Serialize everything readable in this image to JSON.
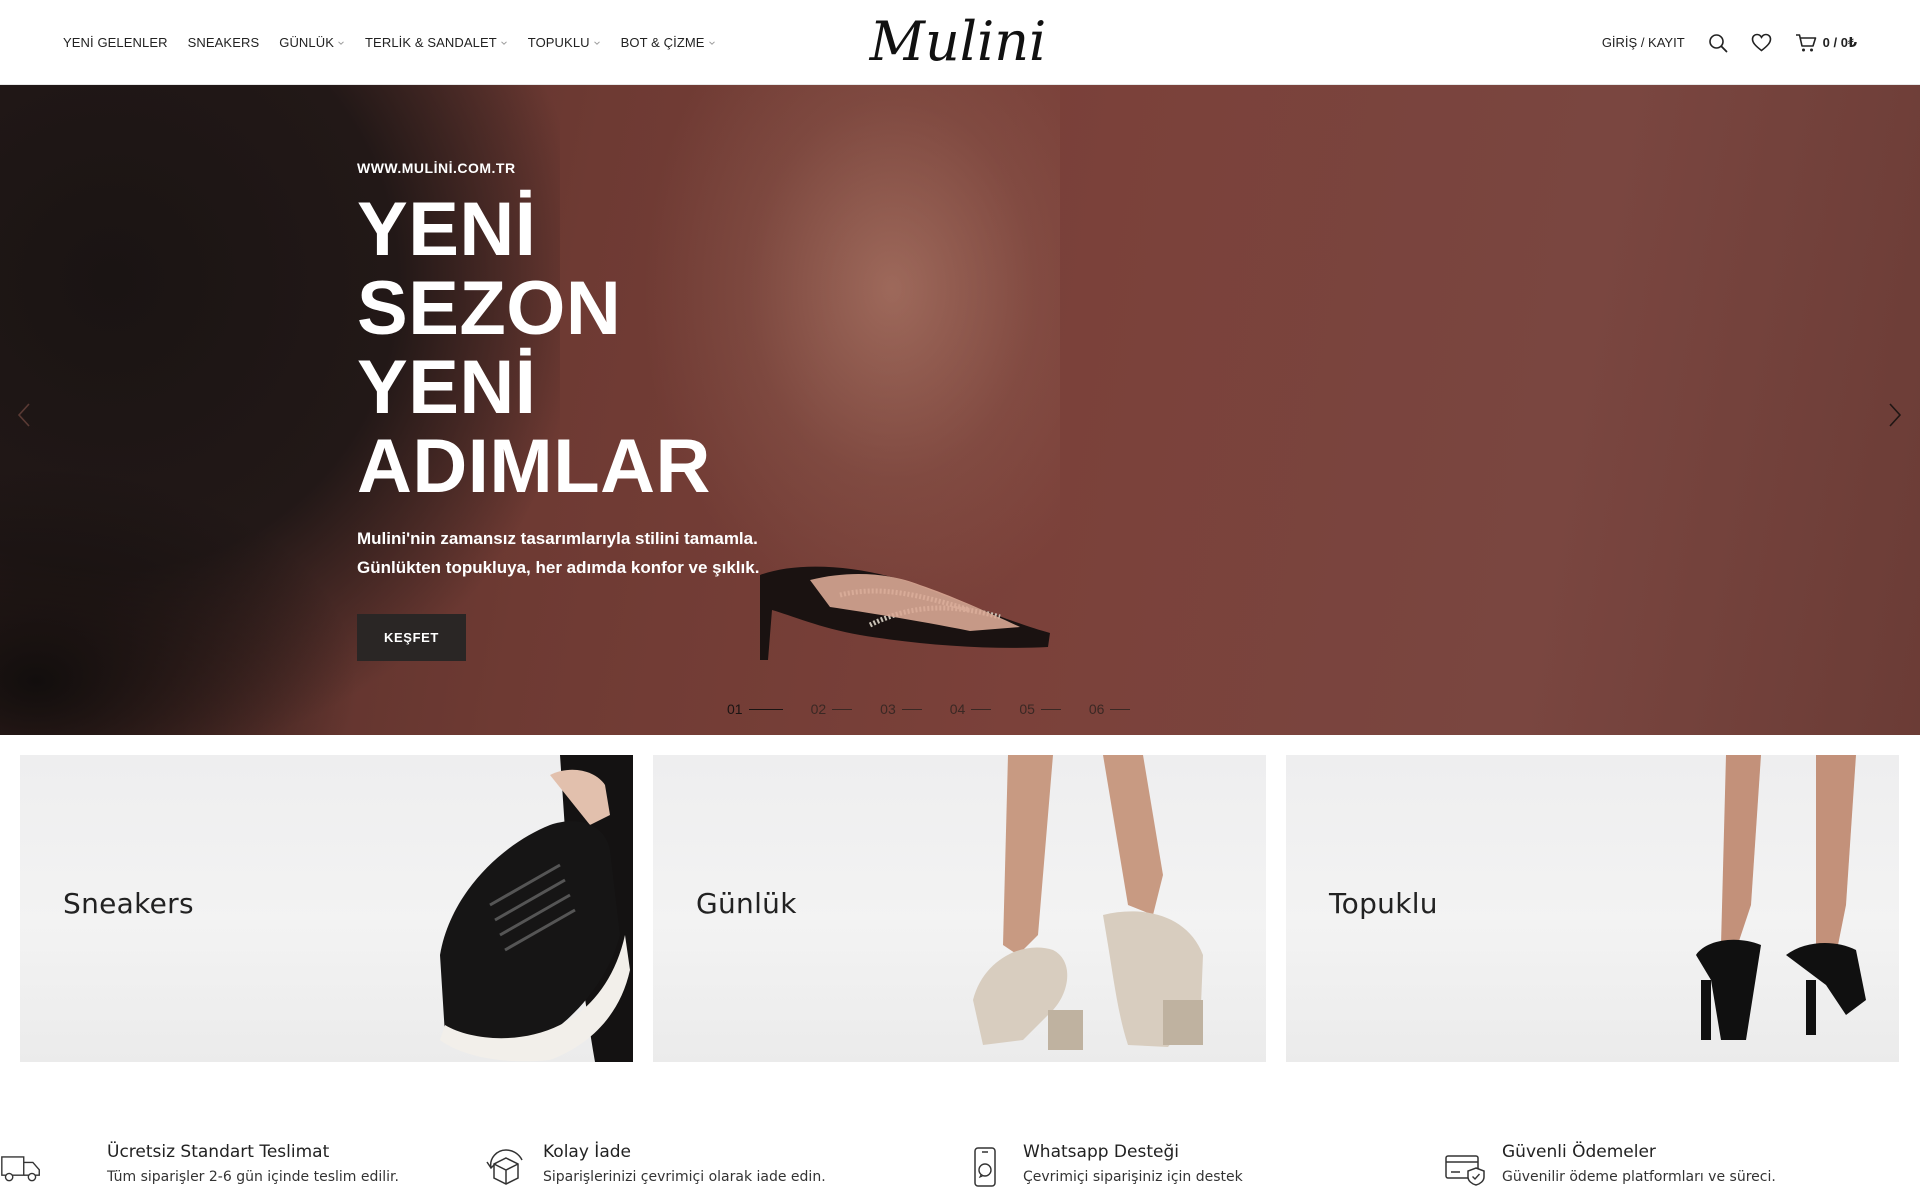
{
  "header": {
    "nav": [
      {
        "label": "YENİ GELENLER",
        "dropdown": false
      },
      {
        "label": "SNEAKERS",
        "dropdown": false
      },
      {
        "label": "GÜNLÜK",
        "dropdown": true
      },
      {
        "label": "TERLİK & SANDALET",
        "dropdown": true
      },
      {
        "label": "TOPUKLU",
        "dropdown": true
      },
      {
        "label": "BOT & ÇİZME",
        "dropdown": true
      }
    ],
    "logo": "Mulini",
    "login_label": "GİRİŞ / KAYIT",
    "cart_label": "0 / 0₺",
    "icons": [
      "search-icon",
      "heart-icon",
      "cart-icon"
    ]
  },
  "hero": {
    "url": "WWW.MULİNİ.COM.TR",
    "title_lines": [
      "YENİ",
      "SEZON",
      "YENİ",
      "ADIMLAR"
    ],
    "desc_lines": [
      "Mulini'nin zamansız tasarımlarıyla stilini tamamla.",
      "Günlükten topukluya, her adımda konfor ve şıklık."
    ],
    "button_label": "KEŞFET",
    "slides": [
      "01",
      "02",
      "03",
      "04",
      "05",
      "06"
    ],
    "active_slide": "01",
    "colors": {
      "background": "#7b413a",
      "button": "#2a2625"
    }
  },
  "categories": [
    {
      "label": "Sneakers"
    },
    {
      "label": "Günlük"
    },
    {
      "label": "Topuklu"
    }
  ],
  "features": [
    {
      "icon": "truck-icon",
      "title": "Ücretsiz Standart Teslimat",
      "desc": "Tüm siparişler 2-6 gün içinde teslim edilir."
    },
    {
      "icon": "return-box-icon",
      "title": "Kolay İade",
      "desc": "Siparişlerinizi çevrimiçi olarak iade edin."
    },
    {
      "icon": "whatsapp-phone-icon",
      "title": "Whatsapp Desteği",
      "desc": "Çevrimiçi siparişiniz için destek"
    },
    {
      "icon": "secure-card-icon",
      "title": "Güvenli Ödemeler",
      "desc": "Güvenilir ödeme platformları ve süreci."
    }
  ]
}
